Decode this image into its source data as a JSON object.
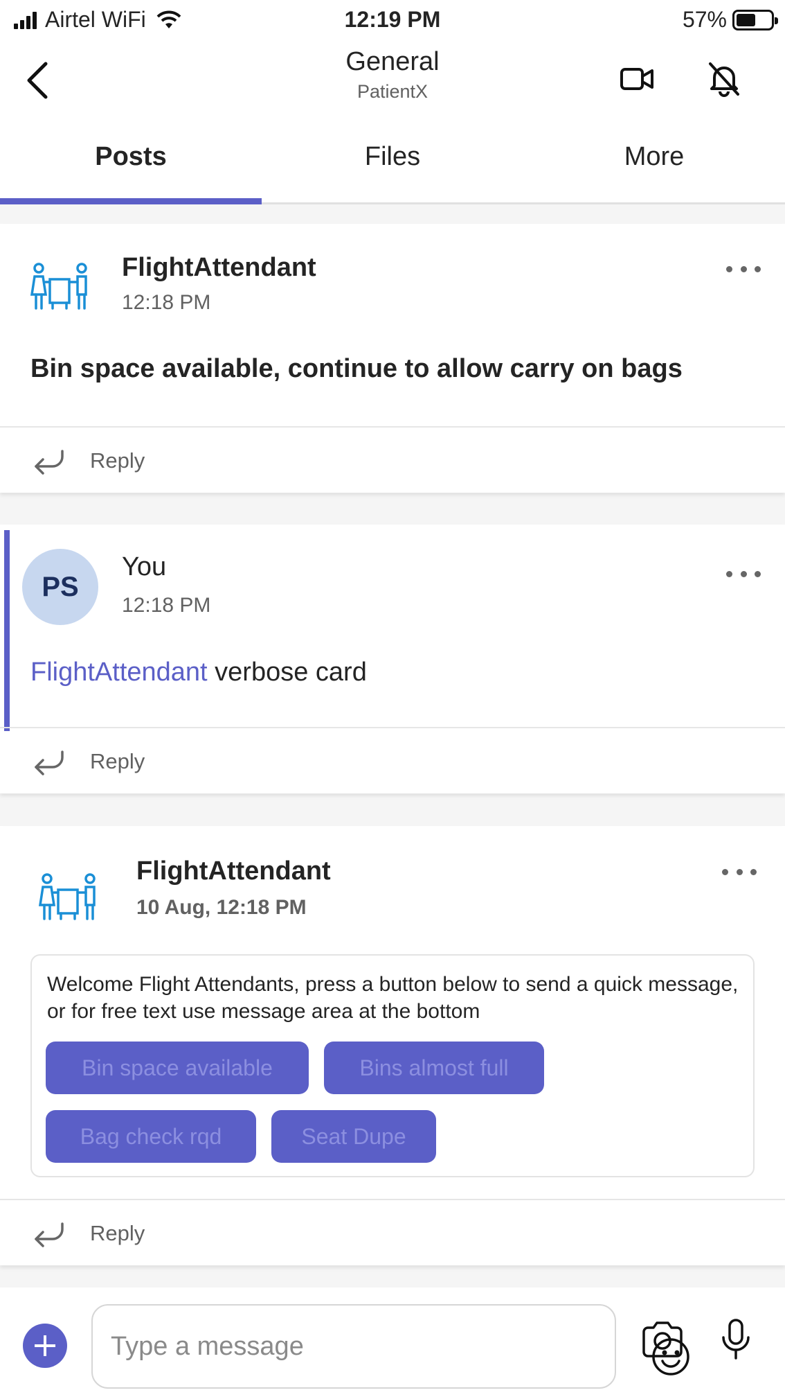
{
  "status_bar": {
    "carrier": "Airtel WiFi",
    "time": "12:19 PM",
    "battery": "57%",
    "battery_level": 0.57
  },
  "header": {
    "title": "General",
    "subtitle": "PatientX",
    "icons": [
      "back-icon",
      "video-call-icon",
      "bell-off-icon"
    ]
  },
  "tabs": [
    {
      "label": "Posts",
      "active": true
    },
    {
      "label": "Files",
      "active": false
    },
    {
      "label": "More",
      "active": false
    }
  ],
  "posts": [
    {
      "author": "FlightAttendant",
      "time": "12:18 PM",
      "message": "Bin space available, continue to allow carry on bags",
      "reply_label": "Reply"
    },
    {
      "author": "You",
      "avatar_initials": "PS",
      "time": "12:18 PM",
      "mention": "FlightAttendant",
      "message": "verbose card",
      "reply_label": "Reply"
    },
    {
      "author": "FlightAttendant",
      "time": "10 Aug, 12:18 PM",
      "card_text": "Welcome Flight Attendants, press a button below to send a quick message, or for free text use message area at the bottom",
      "actions": [
        "Bin space available",
        "Bins almost full",
        "Bag check rqd",
        "Seat Dupe"
      ],
      "reply_label": "Reply"
    }
  ],
  "compose": {
    "placeholder": "Type a message",
    "icons": [
      "add-icon",
      "emoji-icon",
      "camera-icon",
      "microphone-icon"
    ]
  },
  "colors": {
    "accent": "#5b5fc7",
    "mention": "#5b5fc7",
    "avatar_bg": "#c7d7ef",
    "bot_icon": "#1a8fd6"
  }
}
